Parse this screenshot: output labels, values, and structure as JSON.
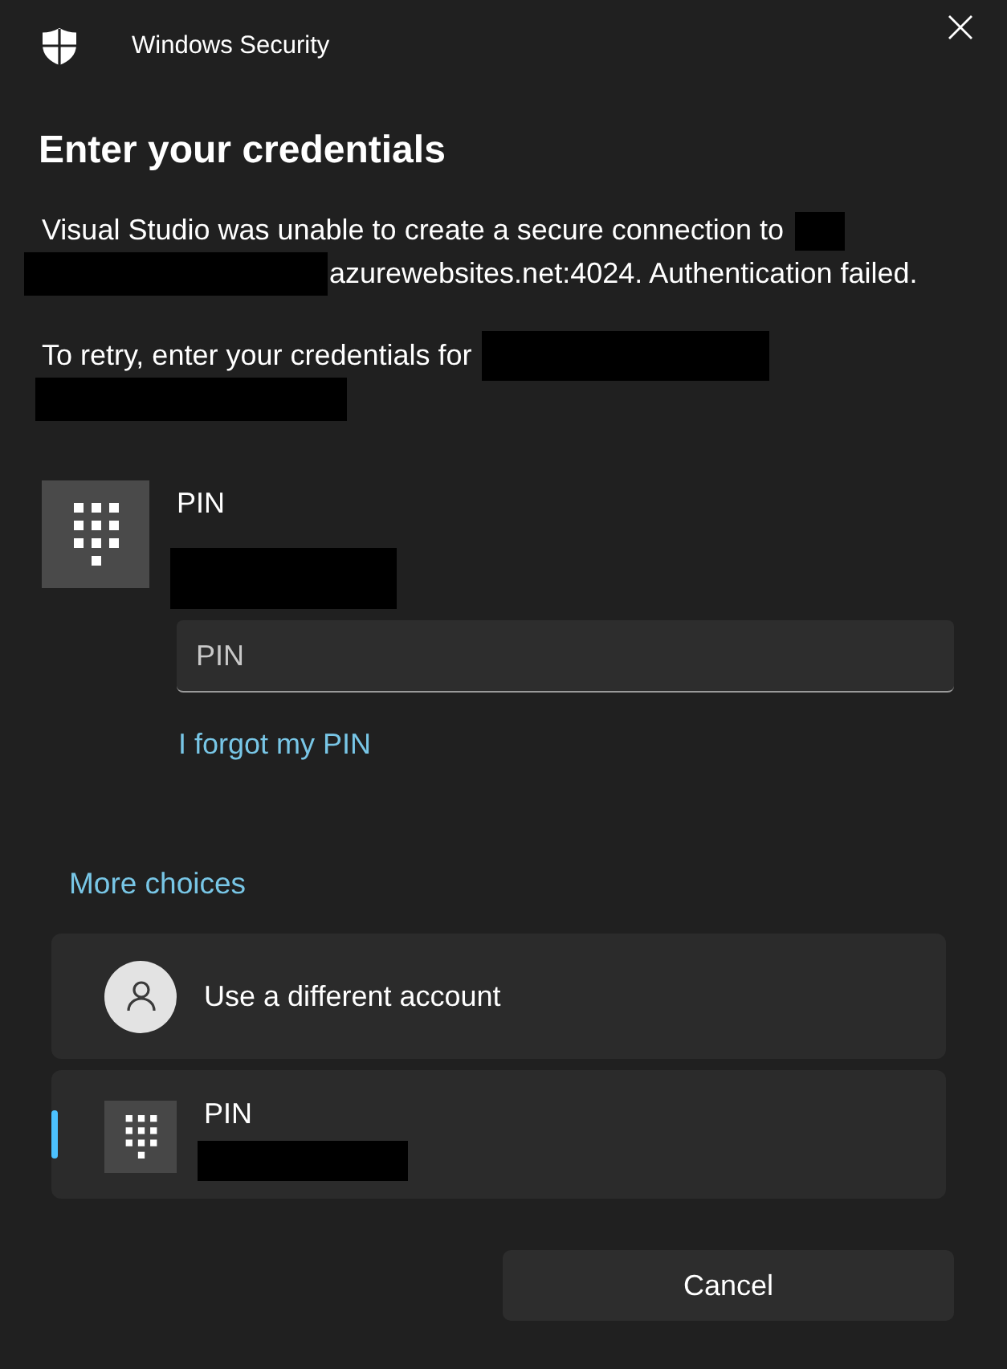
{
  "window": {
    "title": "Windows Security"
  },
  "heading": "Enter your credentials",
  "message_parts": [
    "Visual Studio was unable to create a secure connection to",
    "azurewebsites.net:4024. Authentication failed."
  ],
  "retry_prompt": "To retry, enter your credentials for",
  "credential": {
    "label": "PIN",
    "field": {
      "placeholder": "PIN"
    },
    "forgot_link": "I forgot my PIN"
  },
  "more_choices": {
    "label": "More choices",
    "options": [
      {
        "kind": "account",
        "label": "Use a different account",
        "selected": false
      },
      {
        "kind": "pin",
        "label": "PIN",
        "selected": true
      }
    ]
  },
  "buttons": [
    {
      "label": "Cancel"
    }
  ]
}
